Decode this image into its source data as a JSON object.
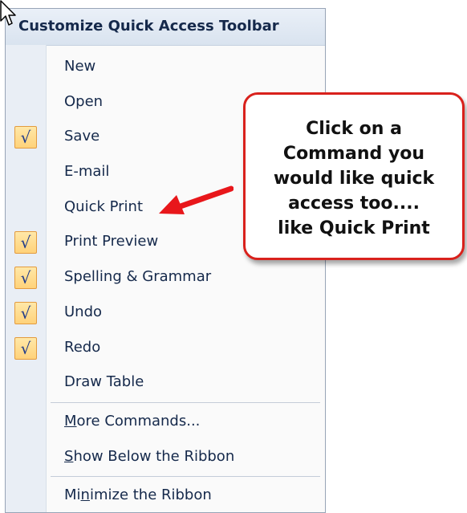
{
  "menu": {
    "title": "Customize Quick Access Toolbar",
    "items": [
      {
        "label": "New",
        "checked": false
      },
      {
        "label": "Open",
        "checked": false
      },
      {
        "label": "Save",
        "checked": true
      },
      {
        "label": "E-mail",
        "checked": false
      },
      {
        "label": "Quick Print",
        "checked": false
      },
      {
        "label": "Print Preview",
        "checked": true
      },
      {
        "label": "Spelling & Grammar",
        "checked": true
      },
      {
        "label": "Undo",
        "checked": true
      },
      {
        "label": "Redo",
        "checked": true
      },
      {
        "label": "Draw Table",
        "checked": false
      }
    ],
    "more_commands": {
      "mnemonic": "M",
      "rest": "ore Commands..."
    },
    "show_below": {
      "mnemonic": "S",
      "rest": "how Below the Ribbon"
    },
    "minimize": {
      "before": "Mi",
      "mnemonic": "n",
      "after": "imize the Ribbon"
    },
    "check_glyph": "√"
  },
  "callout": {
    "lines": [
      "Click on a",
      "Command you",
      "would like quick",
      "access too....",
      "like Quick Print"
    ]
  },
  "colors": {
    "arrow": "#e8171b",
    "callout_border": "#d9211c",
    "check_border": "#e39b3f"
  },
  "icons": {
    "cursor": "mouse-pointer-icon",
    "check": "checkmark-icon",
    "arrow": "red-arrow-icon"
  }
}
